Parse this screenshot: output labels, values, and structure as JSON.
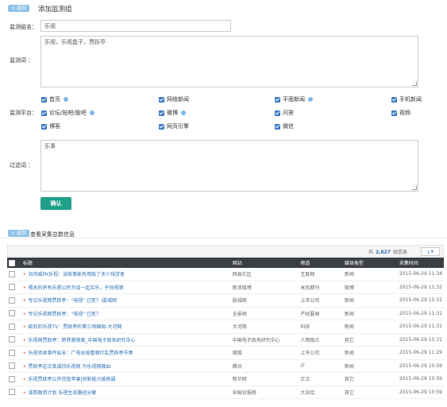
{
  "header": {
    "back_label": "< 返回",
    "title": "添加监测组"
  },
  "form": {
    "group_name_label": "监测组名：",
    "group_name_value": "乐视",
    "keywords_label": "监测词 ：",
    "keywords_value": "乐视，乐视盒子，贾跃亭",
    "platform_label": "监测平台：",
    "platforms": [
      {
        "label": "首页",
        "info": true
      },
      {
        "label": "网络新闻",
        "info": false
      },
      {
        "label": "平面新闻",
        "info": true
      },
      {
        "label": "手机新闻",
        "info": false
      },
      {
        "label": "论坛/贴吧/股吧",
        "info": true
      },
      {
        "label": "微博",
        "info": true
      },
      {
        "label": "问答",
        "info": false
      },
      {
        "label": "视频",
        "info": false
      },
      {
        "label": "博客",
        "info": false
      },
      {
        "label": "网页引擎",
        "info": false
      },
      {
        "label": "微信",
        "info": false
      }
    ],
    "filter_label": "过滤词 ：",
    "filter_value": "乐事",
    "confirm_label": "确认"
  },
  "results": {
    "back_label": "< 返回",
    "title": "查看采集总数信息",
    "total_prefix": "共",
    "total_count": "2,627",
    "total_suffix": "组信息",
    "export_icon": "download-icon",
    "columns": [
      "标题",
      "网站",
      "频道",
      "媒体类型",
      "采集时间"
    ],
    "rows": [
      [
        "刘炜威PK乐视：讲故事能有用赔了多少钱贷者",
        "网易社区",
        "互联网",
        "新闻",
        "2015-06-29 11:34"
      ],
      [
        "揭关的将有乐视公民为谈一起买乐，于别视频",
        "新浪微博",
        "米色期刊",
        "微博",
        "2015-06-29 11:32"
      ],
      [
        "专访乐视网贾跃亭：\"电视\" 已死？-股城网",
        "股城网",
        "上市公司",
        "新闻",
        "2015-06-29 11:31"
      ],
      [
        "专访乐视网贾跃亭：\"电视\" 已死？",
        "全景网",
        "产经要闻",
        "新闻",
        "2015-06-29 11:31"
      ],
      [
        "疯狂的乐视TV：贾跃亭的第三场赌局-大河网",
        "大河网",
        "科技",
        "新闻",
        "2015-06-29 11:31"
      ],
      [
        "乐视网贾跃亭：跨界营销案_中国电子商务研究中心",
        "中国电子商务研究中心",
        "人物观点",
        "其它",
        "2015-06-29 11:31"
      ],
      [
        "乐视资本事件始末：广电总局整顿打乱贾跃亭节奏",
        "搜狐",
        "上市公司",
        "新闻",
        "2015-06-29 11:29"
      ],
      [
        "贾跃亭这次真减持乐视网 为乐视网输血",
        "腾讯",
        "IT",
        "新闻",
        "2015-06-29 10:59"
      ],
      [
        "乐视贾跃亭公开信批苹果|创新能力被削弱",
        "新华网",
        "正文",
        "其它",
        "2015-06-29 10:59"
      ],
      [
        "涨跌融资计划 乐视生态路径分解",
        "中国日报网",
        "大杂烩",
        "其它",
        "2015-06-29 10:59"
      ]
    ]
  },
  "colors": {
    "accent": "#20a08a",
    "link": "#2a6fb5",
    "checkbox": "#3b7cc4",
    "header_bg": "#3a3f44",
    "back_btn": "#8ec2e8"
  }
}
